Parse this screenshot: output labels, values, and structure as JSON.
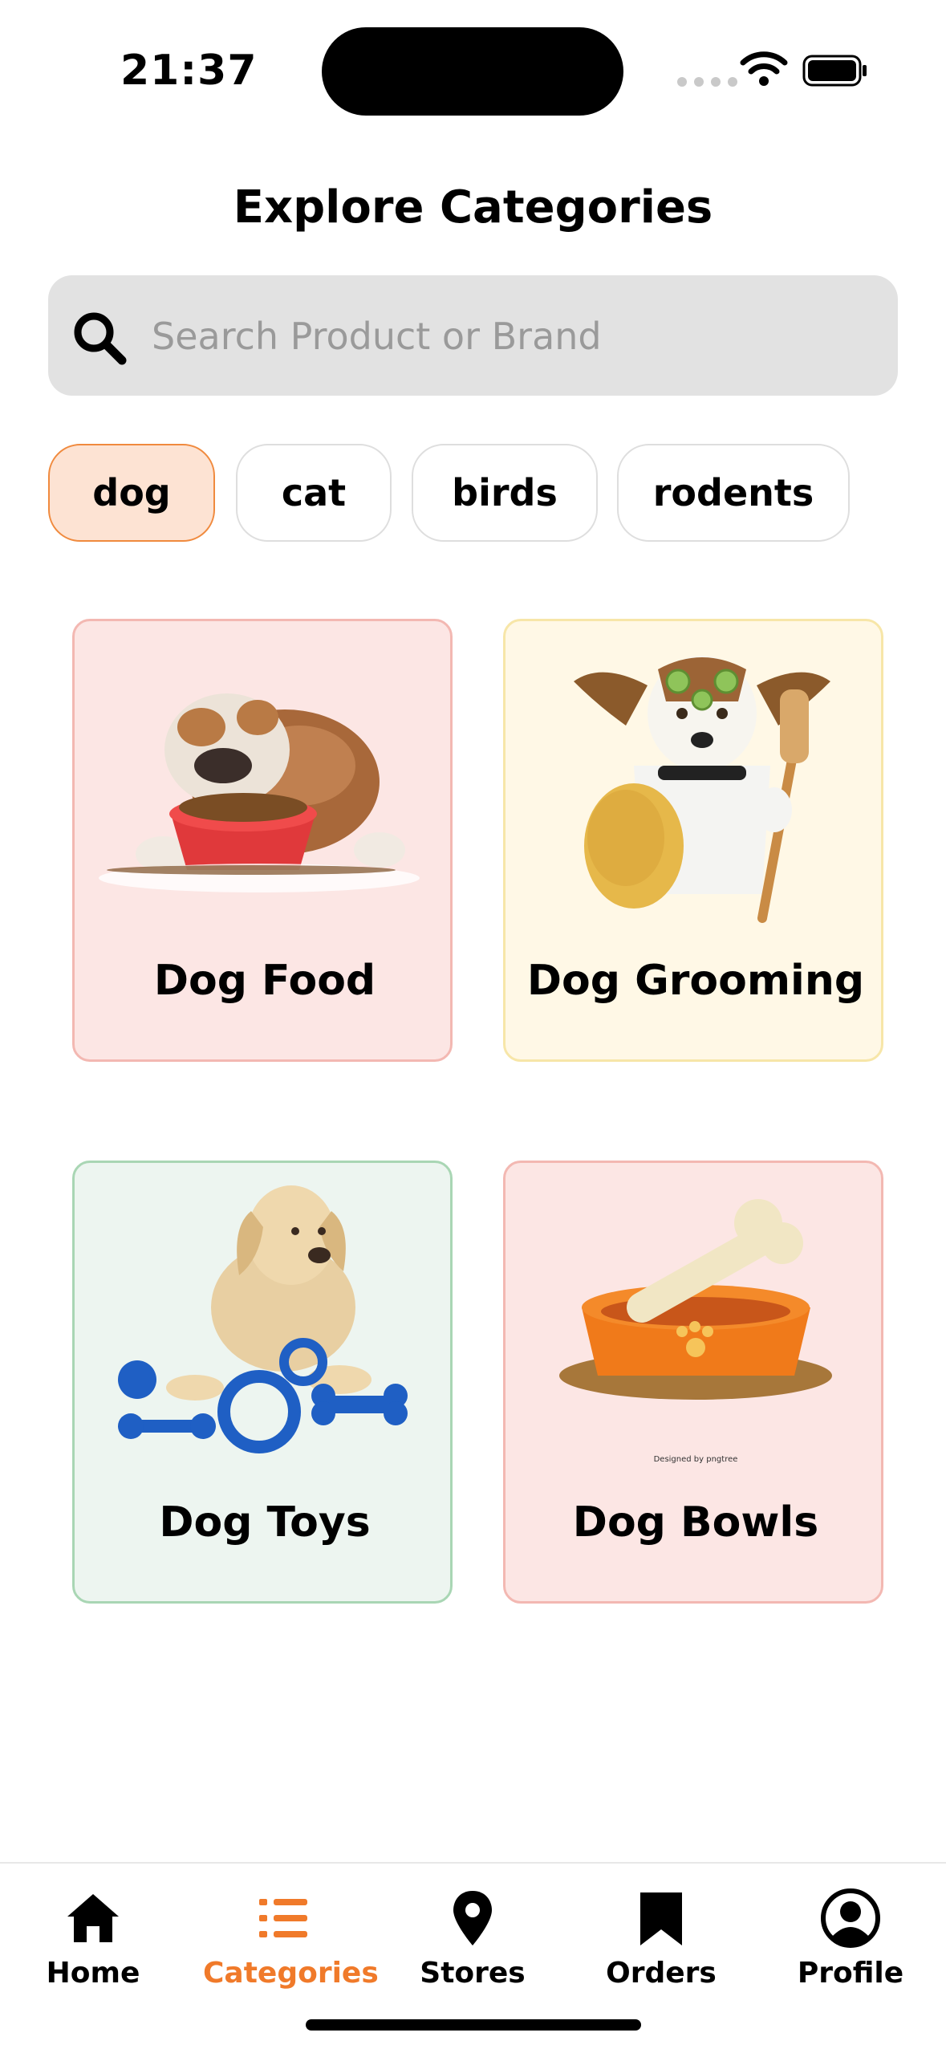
{
  "status": {
    "time": "21:37"
  },
  "header": {
    "title": "Explore Categories"
  },
  "search": {
    "placeholder": "Search Product or Brand"
  },
  "chips": [
    {
      "label": "dog",
      "selected": true
    },
    {
      "label": "cat",
      "selected": false
    },
    {
      "label": "birds",
      "selected": false
    },
    {
      "label": "rodents",
      "selected": false
    }
  ],
  "categories": [
    {
      "label": "Dog Food",
      "image": "bulldog-eating-food-bowl"
    },
    {
      "label": "Dog Grooming",
      "image": "dog-spa-cucumber-mask"
    },
    {
      "label": "Dog Toys",
      "image": "labrador-with-blue-toys"
    },
    {
      "label": "Dog Bowls",
      "image": "orange-bowl-with-bone",
      "watermark": "Designed by pngtree"
    }
  ],
  "tabs": [
    {
      "label": "Home",
      "icon": "home-icon"
    },
    {
      "label": "Categories",
      "icon": "list-icon",
      "active": true
    },
    {
      "label": "Stores",
      "icon": "location-pin-icon"
    },
    {
      "label": "Orders",
      "icon": "bookmark-icon"
    },
    {
      "label": "Profile",
      "icon": "user-circle-icon"
    }
  ],
  "colors": {
    "accent": "#f07a2a",
    "chip_active_bg": "#fde3d3",
    "search_bg": "#e2e2e2"
  }
}
